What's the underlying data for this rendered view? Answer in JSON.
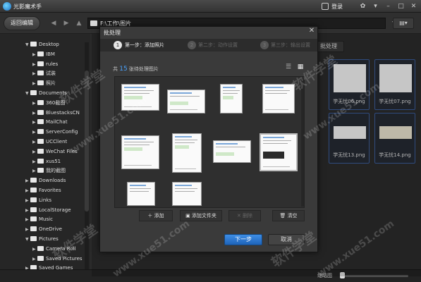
{
  "app": {
    "title": "光影魔术手",
    "login": "登录"
  },
  "toolbar": {
    "back_edit": "返回编辑",
    "path": "F:\\工作\\图片",
    "view_menu": "▤▾"
  },
  "sidebar": {
    "items": [
      {
        "label": "Desktop",
        "level": 1,
        "expanded": true
      },
      {
        "label": "IBM",
        "level": 2
      },
      {
        "label": "rules",
        "level": 2
      },
      {
        "label": "试装",
        "level": 2
      },
      {
        "label": "照片",
        "level": 2
      },
      {
        "label": "Documents",
        "level": 1,
        "expanded": true
      },
      {
        "label": "360截图",
        "level": 2
      },
      {
        "label": "BluestacksCN",
        "level": 2
      },
      {
        "label": "MailChat",
        "level": 2
      },
      {
        "label": "ServerConfig",
        "level": 2
      },
      {
        "label": "UCClient",
        "level": 2
      },
      {
        "label": "WeChat Files",
        "level": 2
      },
      {
        "label": "xus51",
        "level": 2
      },
      {
        "label": "我的截图",
        "level": 2
      },
      {
        "label": "Downloads",
        "level": 1
      },
      {
        "label": "Favorites",
        "level": 1
      },
      {
        "label": "Links",
        "level": 1
      },
      {
        "label": "LocalStorage",
        "level": 1
      },
      {
        "label": "Music",
        "level": 1
      },
      {
        "label": "OneDrive",
        "level": 1
      },
      {
        "label": "Pictures",
        "level": 1,
        "expanded": true
      },
      {
        "label": "Camera Roll",
        "level": 2
      },
      {
        "label": "Saved Pictures",
        "level": 2
      },
      {
        "label": "Saved Games",
        "level": 1
      }
    ]
  },
  "main": {
    "batch_button": "批处理",
    "thumbs": [
      {
        "caption": "学无忧06.png"
      },
      {
        "caption": "学无忧07.png"
      },
      {
        "caption": "学无忧13.png"
      },
      {
        "caption": "学无忧14.png"
      }
    ],
    "thumb_size_label": "缩略图"
  },
  "dialog": {
    "title": "批处理",
    "steps": [
      {
        "num": "1",
        "label": "第一步：添加照片"
      },
      {
        "num": "2",
        "label": "第二步：动作设置"
      },
      {
        "num": "3",
        "label": "第三步：输出设置"
      }
    ],
    "count_prefix": "共",
    "count": "15",
    "count_suffix": "张待处理图片",
    "buttons": {
      "add": "添加",
      "add_folder": "添加文件夹",
      "delete": "删除",
      "clear": "清空"
    },
    "next": "下一步",
    "cancel": "取消"
  },
  "watermark": {
    "text_cn": "软件学堂",
    "text_url": "www.xue51.com"
  }
}
